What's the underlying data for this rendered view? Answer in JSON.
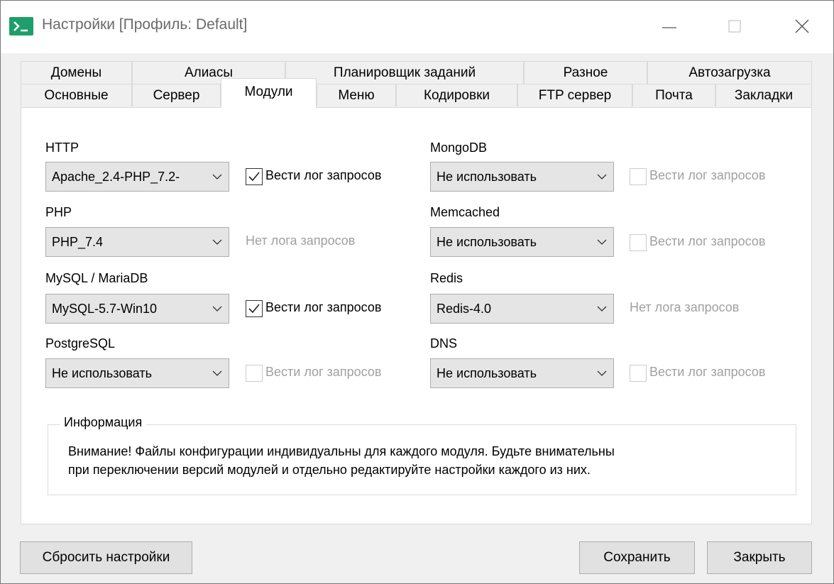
{
  "window": {
    "title": "Настройки [Профиль: Default]"
  },
  "tabs": {
    "top": [
      "Домены",
      "Алиасы",
      "Планировщик заданий",
      "Разное",
      "Автозагрузка"
    ],
    "bottom": [
      "Основные",
      "Сервер",
      "Модули",
      "Меню",
      "Кодировки",
      "FTP сервер",
      "Почта",
      "Закладки"
    ],
    "active": "Модули"
  },
  "modules": {
    "http": {
      "label": "HTTP",
      "value": "Apache_2.4-PHP_7.2-",
      "log_label": "Вести лог запросов",
      "log_checked": true,
      "log_enabled": true
    },
    "php": {
      "label": "PHP",
      "value": "PHP_7.4",
      "nolog": "Нет лога запросов"
    },
    "mysql": {
      "label": "MySQL / MariaDB",
      "value": "MySQL-5.7-Win10",
      "log_label": "Вести лог запросов",
      "log_checked": true,
      "log_enabled": true
    },
    "postgres": {
      "label": "PostgreSQL",
      "value": "Не использовать",
      "log_label": "Вести лог запросов",
      "log_checked": false,
      "log_enabled": false
    },
    "mongodb": {
      "label": "MongoDB",
      "value": "Не использовать",
      "log_label": "Вести лог запросов",
      "log_checked": false,
      "log_enabled": false
    },
    "memcached": {
      "label": "Memcached",
      "value": "Не использовать",
      "log_label": "Вести лог запросов",
      "log_checked": false,
      "log_enabled": false
    },
    "redis": {
      "label": "Redis",
      "value": "Redis-4.0",
      "nolog": "Нет лога запросов"
    },
    "dns": {
      "label": "DNS",
      "value": "Не использовать",
      "log_label": "Вести лог запросов",
      "log_checked": false,
      "log_enabled": false
    }
  },
  "info": {
    "legend": "Информация",
    "line1": "Внимание! Файлы конфигурации индивидуальны для каждого модуля. Будьте внимательны",
    "line2": "при переключении версий модулей и отдельно редактируйте настройки каждого из них."
  },
  "buttons": {
    "reset": "Сбросить настройки",
    "save": "Сохранить",
    "close": "Закрыть"
  },
  "colors": {
    "app_icon": "#1e9e6a",
    "panel": "#ffffff",
    "chrome": "#f0f0f0"
  }
}
